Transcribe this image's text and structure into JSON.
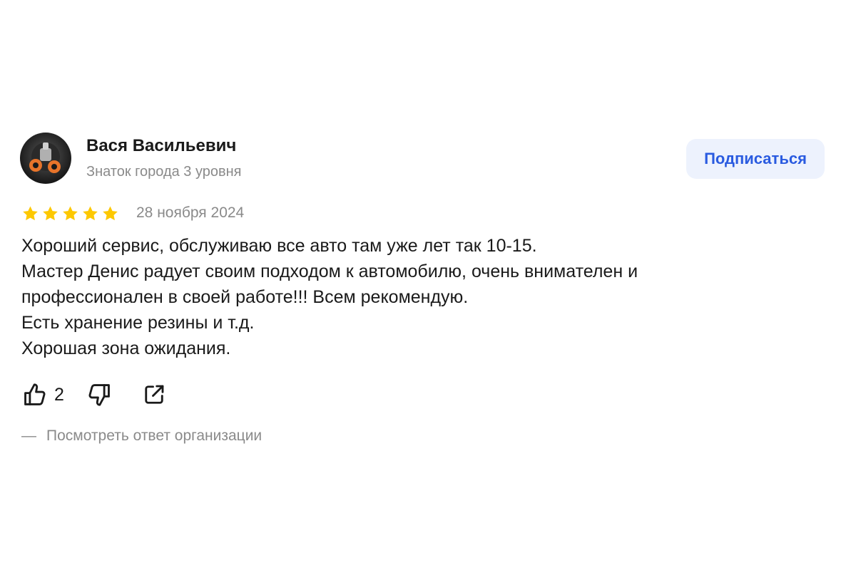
{
  "author": {
    "name": "Вася Васильевич",
    "level": "Знаток города 3 уровня",
    "avatar_icon": "avatar-photo"
  },
  "subscribe_label": "Подписаться",
  "rating": {
    "value": 5,
    "max": 5,
    "star_color": "#fdc800"
  },
  "date": "28 ноября 2024",
  "review_lines": [
    "Хороший сервис, обслуживаю все авто там уже лет так 10-15.",
    "Мастер Денис радует своим подходом к автомобилю, очень внимателен и",
    "профессионален в своей работе!!! Всем рекомендую.",
    "Есть хранение резины и т.д.",
    "Хорошая зона ожидания."
  ],
  "actions": {
    "like_icon": "thumbs-up-icon",
    "like_count": "2",
    "dislike_icon": "thumbs-down-icon",
    "share_icon": "share-icon"
  },
  "org_reply": {
    "dash": "—",
    "label": "Посмотреть ответ организации"
  },
  "colors": {
    "accent": "#2a5be0",
    "button_bg": "#edf2fd",
    "muted_text": "#8a8a8a"
  }
}
